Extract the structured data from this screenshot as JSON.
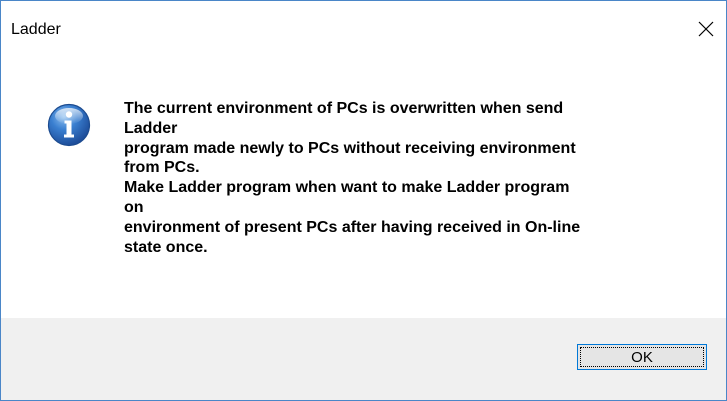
{
  "window": {
    "title": "Ladder"
  },
  "icons": {
    "close": "close-icon",
    "info": "info-icon"
  },
  "message": {
    "lines": [
      "The current environment of PCs is overwritten when send",
      "Ladder",
      "program made newly to PCs without receiving environment",
      "from PCs.",
      "Make Ladder program when want to make Ladder program",
      "on",
      "environment of present PCs after having received in On-line",
      "state once."
    ]
  },
  "buttons": {
    "ok_label": "OK"
  },
  "colors": {
    "border": "#4a86c8",
    "footer_bg": "#f0f0f0",
    "button_border": "#0078d7",
    "button_bg": "#e5e5e5",
    "icon_blue": "#2b5fa8"
  }
}
